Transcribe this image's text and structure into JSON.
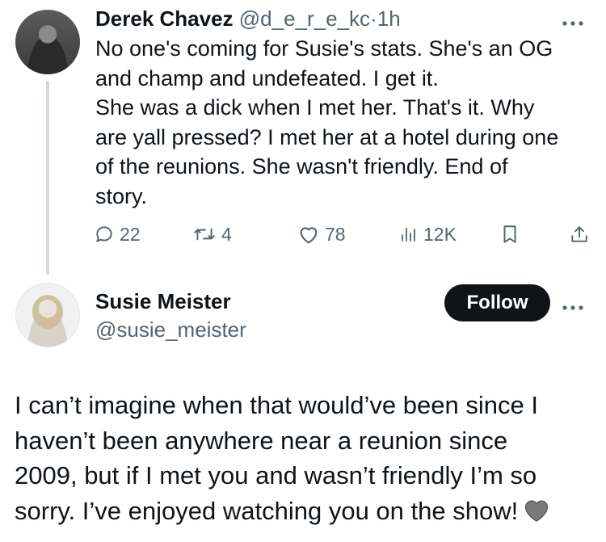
{
  "reply_tweet": {
    "author_name": "Derek Chavez",
    "author_handle": "@d_e_r_e_kc",
    "separator": "·",
    "time": "1h",
    "more_icon": "more-horizontal-icon",
    "text": "No one's coming for Susie's stats. She's an OG\nand champ and undefeated. I get it.\nShe was a dick when I met her. That's it. Why\nare yall pressed? I  met her at a hotel during one\nof the reunions. She wasn't friendly. End of\nstory.",
    "actions": {
      "replies": "22",
      "reposts": "4",
      "likes": "78",
      "views": "12K"
    }
  },
  "main_tweet": {
    "author_name": "Susie Meister",
    "author_handle": "@susie_meister",
    "follow_label": "Follow",
    "text": "I can’t imagine when that would’ve been since I\nhaven’t been anywhere near a reunion since\n2009, but if I met you and wasn’t friendly I’m so\nsorry. I’ve enjoyed watching you on the show!",
    "emoji": "grey-heart-icon"
  },
  "colors": {
    "text": "#0f1419",
    "muted": "#536471",
    "thread_line": "#cfd9de",
    "button_bg": "#0f1419"
  }
}
